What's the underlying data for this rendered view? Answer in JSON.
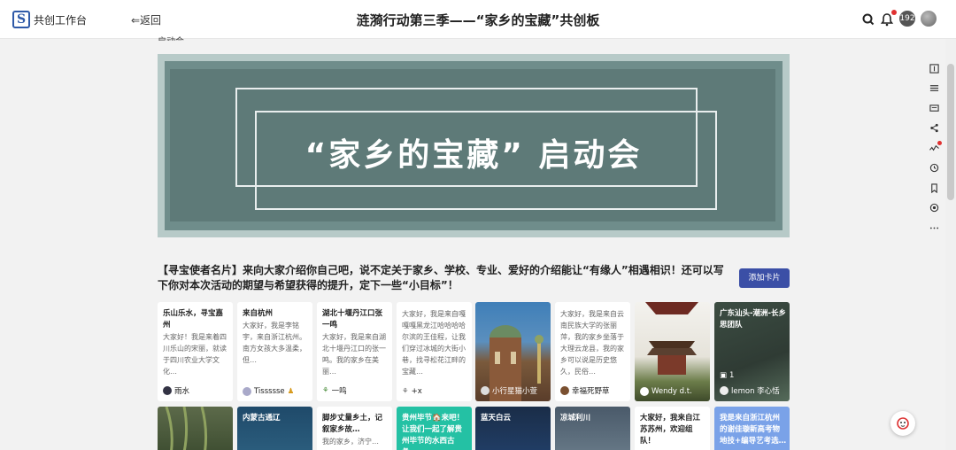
{
  "header": {
    "brand": "共创工作台",
    "back": "⇐返回",
    "title": "涟漪行动第三季——“家乡的宝藏”共创板",
    "notification_count": "192"
  },
  "section_cut_label": "启动会",
  "banner": {
    "text": "“家乡的宝藏” 启动会"
  },
  "prompt": {
    "text": "【寻宝使者名片】来向大家介绍你自己吧，说不定关于家乡、学校、专业、爱好的介绍能让“有缘人”相遇相识！还可以写下你对本次活动的期望与希望获得的提升，定下一些“小目标”！",
    "add_card": "添加卡片"
  },
  "cards_row1": [
    {
      "title": "乐山乐水，寻宝嘉州",
      "body": "大家好！我是来着四川乐山的宋丽，就读于四川农业大学文化…",
      "user": "雨水"
    },
    {
      "title": "来自杭州",
      "body": "大家好，我是李铭宇，来自浙江杭州。南方女孩大多温柔，但…",
      "user": "Tissssse"
    },
    {
      "title": "湖北十堰丹江口张一鸣",
      "body": "大家好，我是来自湖北十堰丹江口的张一鸣。我的家乡在美丽…",
      "user": "一鸣"
    },
    {
      "title": "",
      "body": "大家好，我是来自嘎嘎嘎黑龙江哈哈哈哈尔滨的王佳程，让我们穿过冰城的大街小巷，找寻松花江畔的宝藏…",
      "user": "+x"
    },
    {
      "title": "",
      "body": "",
      "user": "小行星猫小萱"
    },
    {
      "title": "",
      "body": "大家好，我是来自云南民族大学的张丽萍，我的家乡坐落于大理云龙县，我的家乡可以说是历史悠久，民俗…",
      "user": "幸福死野草"
    },
    {
      "title": "",
      "body": "",
      "user": "Wendy d.t."
    },
    {
      "title": "广东汕头-潮洲-长乡思团队",
      "body": "",
      "user": "lemon 李心恬",
      "count": "1"
    }
  ],
  "cards_row2": [
    {
      "title": "",
      "body": ""
    },
    {
      "title": "内蒙古通辽",
      "body": ""
    },
    {
      "title": "脚步丈量乡土，记叙家乡故…",
      "body": "我的家乡，济宁…"
    },
    {
      "title": "贵州毕节🏠来吧！让我们一起了解贵州毕节的水西古彝…",
      "body": ""
    },
    {
      "title": "蓝天白云",
      "body": ""
    },
    {
      "title": "凉城利川",
      "body": ""
    },
    {
      "title": "大家好，我来自江苏苏州，欢迎组队！",
      "body": ""
    },
    {
      "title": "我是来自浙江杭州的谢佳璇新高考物地技+编导艺考选…",
      "body": ""
    }
  ],
  "icons": {
    "top": [
      "search-icon",
      "bell-icon"
    ],
    "side": [
      "panel-icon",
      "list-icon",
      "comment-icon",
      "share-icon",
      "activity-icon",
      "history-icon",
      "bookmark-icon",
      "target-icon",
      "more-icon"
    ]
  }
}
